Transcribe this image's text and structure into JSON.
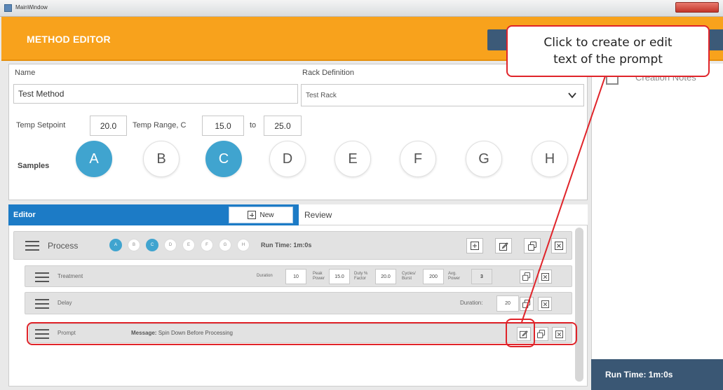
{
  "window": {
    "title": "MainWindow"
  },
  "header": {
    "title": "METHOD EDITOR"
  },
  "method": {
    "name_label": "Name",
    "name_value": "Test Method",
    "rack_label": "Rack Definition",
    "rack_value": "Test Rack",
    "temp_setpoint_label": "Temp Setpoint",
    "temp_setpoint_value": "20.0",
    "temp_range_label": "Temp Range, C",
    "temp_range_min": "15.0",
    "temp_range_to": "to",
    "temp_range_max": "25.0",
    "samples_label": "Samples",
    "samples": [
      {
        "label": "A",
        "selected": true
      },
      {
        "label": "B",
        "selected": false
      },
      {
        "label": "C",
        "selected": true
      },
      {
        "label": "D",
        "selected": false
      },
      {
        "label": "E",
        "selected": false
      },
      {
        "label": "F",
        "selected": false
      },
      {
        "label": "G",
        "selected": false
      },
      {
        "label": "H",
        "selected": false
      }
    ]
  },
  "side": {
    "notes_label": "Creation Notes",
    "run_time": "Run Time: 1m:0s"
  },
  "tabs": {
    "editor": "Editor",
    "new": "New",
    "review": "Review"
  },
  "process": {
    "label": "Process",
    "run_time": "Run Time: 1m:0s",
    "samples": [
      "A",
      "B",
      "C",
      "D",
      "E",
      "F",
      "G",
      "H"
    ],
    "selected": [
      "A",
      "C"
    ]
  },
  "treatment": {
    "label": "Treatment",
    "duration_label": "Duration",
    "duration": "10",
    "peak_power_label": [
      "Peak",
      "Power"
    ],
    "peak_power": "15.0",
    "duty_label": [
      "Duty %",
      "Factor"
    ],
    "duty": "20.0",
    "cycles_label": [
      "Cycles/",
      "Burst"
    ],
    "cycles": "200",
    "avg_power_label": [
      "Avg.",
      "Power"
    ],
    "avg_power": "3"
  },
  "delay": {
    "label": "Delay",
    "duration_label": "Duration:",
    "duration": "20"
  },
  "prompt": {
    "label": "Prompt",
    "message_label": "Message:",
    "message": "Spin Down Before Processing"
  },
  "callout": {
    "lines": [
      "Click to create or edit",
      "text of the prompt"
    ]
  },
  "colors": {
    "header": "#f8a21c",
    "accent": "#40a4cf",
    "editor_tab": "#1c7bc6",
    "run_bar": "#3a5774",
    "annotation": "#e0242a"
  },
  "icons": {
    "add": "plus-square-icon",
    "edit": "edit-pencil-icon",
    "copy": "copy-icon",
    "delete": "delete-square-icon",
    "menu": "hamburger-icon",
    "chevron": "chevron-down-icon"
  }
}
